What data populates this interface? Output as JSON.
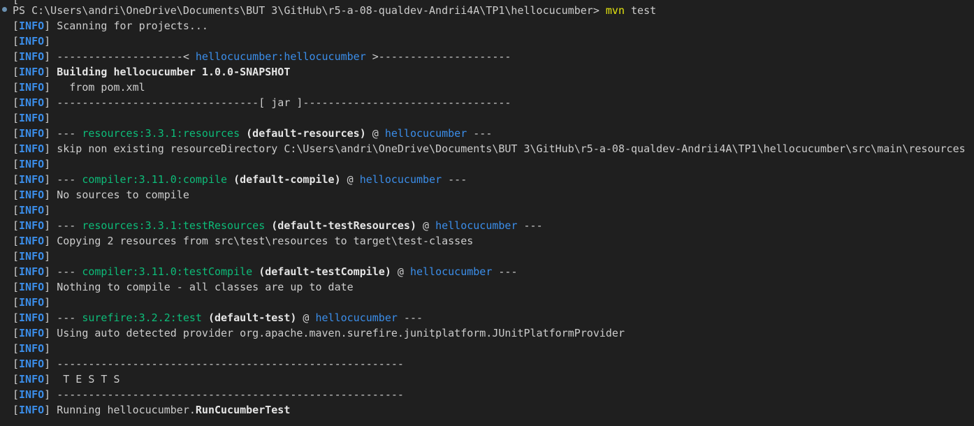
{
  "terminal": {
    "prefix_open": "[",
    "prefix_tag": "INFO",
    "prefix_close": "]",
    "prompt": {
      "path": "PS C:\\Users\\andri\\OneDrive\\Documents\\BUT 3\\GitHub\\r5-a-08-qualdev-Andrii4A\\TP1\\hellocucumber> ",
      "command": "mvn",
      "args": " test"
    },
    "colors": {
      "background": "#1f1f1f",
      "text": "#cccccc",
      "info_tag": "#3b8eea",
      "command": "#e5e510",
      "plugin": "#0dbc79",
      "project": "#3b8eea"
    },
    "lines": [
      {
        "segments": [
          {
            "t": "Scanning for projects...",
            "s": "plain"
          }
        ]
      },
      {
        "segments": []
      },
      {
        "segments": [
          {
            "t": "--------------------< ",
            "s": "plain"
          },
          {
            "t": "hellocucumber:hellocucumber",
            "s": "proj"
          },
          {
            "t": " >---------------------",
            "s": "plain"
          }
        ]
      },
      {
        "segments": [
          {
            "t": "Building hellocucumber 1.0.0-SNAPSHOT",
            "s": "bold"
          }
        ]
      },
      {
        "segments": [
          {
            "t": "  from pom.xml",
            "s": "plain"
          }
        ]
      },
      {
        "segments": [
          {
            "t": "--------------------------------[ jar ]---------------------------------",
            "s": "plain"
          }
        ]
      },
      {
        "segments": []
      },
      {
        "segments": [
          {
            "t": "--- ",
            "s": "plain"
          },
          {
            "t": "resources:3.3.1:resources",
            "s": "plug"
          },
          {
            "t": " ",
            "s": "plain"
          },
          {
            "t": "(default-resources)",
            "s": "bold"
          },
          {
            "t": " @ ",
            "s": "plain"
          },
          {
            "t": "hellocucumber",
            "s": "proj"
          },
          {
            "t": " ---",
            "s": "plain"
          }
        ]
      },
      {
        "segments": [
          {
            "t": "skip non existing resourceDirectory C:\\Users\\andri\\OneDrive\\Documents\\BUT 3\\GitHub\\r5-a-08-qualdev-Andrii4A\\TP1\\hellocucumber\\src\\main\\resources",
            "s": "plain"
          }
        ]
      },
      {
        "segments": []
      },
      {
        "segments": [
          {
            "t": "--- ",
            "s": "plain"
          },
          {
            "t": "compiler:3.11.0:compile",
            "s": "plug"
          },
          {
            "t": " ",
            "s": "plain"
          },
          {
            "t": "(default-compile)",
            "s": "bold"
          },
          {
            "t": " @ ",
            "s": "plain"
          },
          {
            "t": "hellocucumber",
            "s": "proj"
          },
          {
            "t": " ---",
            "s": "plain"
          }
        ]
      },
      {
        "segments": [
          {
            "t": "No sources to compile",
            "s": "plain"
          }
        ]
      },
      {
        "segments": []
      },
      {
        "segments": [
          {
            "t": "--- ",
            "s": "plain"
          },
          {
            "t": "resources:3.3.1:testResources",
            "s": "plug"
          },
          {
            "t": " ",
            "s": "plain"
          },
          {
            "t": "(default-testResources)",
            "s": "bold"
          },
          {
            "t": " @ ",
            "s": "plain"
          },
          {
            "t": "hellocucumber",
            "s": "proj"
          },
          {
            "t": " ---",
            "s": "plain"
          }
        ]
      },
      {
        "segments": [
          {
            "t": "Copying 2 resources from src\\test\\resources to target\\test-classes",
            "s": "plain"
          }
        ]
      },
      {
        "segments": []
      },
      {
        "segments": [
          {
            "t": "--- ",
            "s": "plain"
          },
          {
            "t": "compiler:3.11.0:testCompile",
            "s": "plug"
          },
          {
            "t": " ",
            "s": "plain"
          },
          {
            "t": "(default-testCompile)",
            "s": "bold"
          },
          {
            "t": " @ ",
            "s": "plain"
          },
          {
            "t": "hellocucumber",
            "s": "proj"
          },
          {
            "t": " ---",
            "s": "plain"
          }
        ]
      },
      {
        "segments": [
          {
            "t": "Nothing to compile - all classes are up to date",
            "s": "plain"
          }
        ]
      },
      {
        "segments": []
      },
      {
        "segments": [
          {
            "t": "--- ",
            "s": "plain"
          },
          {
            "t": "surefire:3.2.2:test",
            "s": "plug"
          },
          {
            "t": " ",
            "s": "plain"
          },
          {
            "t": "(default-test)",
            "s": "bold"
          },
          {
            "t": " @ ",
            "s": "plain"
          },
          {
            "t": "hellocucumber",
            "s": "proj"
          },
          {
            "t": " ---",
            "s": "plain"
          }
        ]
      },
      {
        "segments": [
          {
            "t": "Using auto detected provider org.apache.maven.surefire.junitplatform.JUnitPlatformProvider",
            "s": "plain"
          }
        ]
      },
      {
        "segments": []
      },
      {
        "segments": [
          {
            "t": "-------------------------------------------------------",
            "s": "plain"
          }
        ]
      },
      {
        "segments": [
          {
            "t": " T E S T S",
            "s": "plain"
          }
        ]
      },
      {
        "segments": [
          {
            "t": "-------------------------------------------------------",
            "s": "plain"
          }
        ]
      },
      {
        "segments": [
          {
            "t": "Running hellocucumber.",
            "s": "plain"
          },
          {
            "t": "RunCucumberTest",
            "s": "bold"
          }
        ]
      }
    ]
  }
}
